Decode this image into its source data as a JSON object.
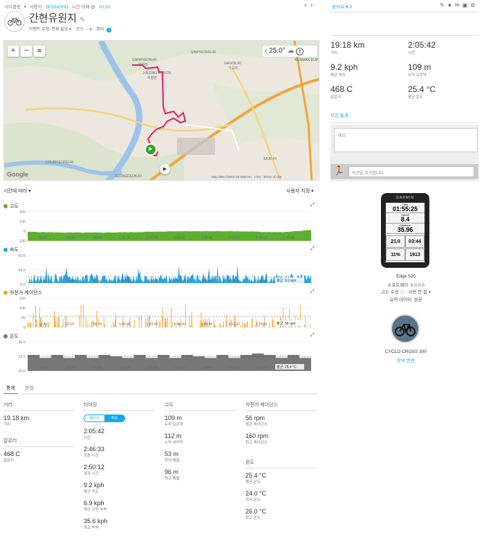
{
  "header": {
    "breadcrumb": [
      "사이클링",
      "▾",
      "사용자",
      "SEONGHO",
      "시간 어제 @",
      "10:33"
    ],
    "title": "간현유원지",
    "meta_event": "이벤트 유형: 분류 없음 ▾",
    "meta_course": "코스: -- ▾",
    "meta_device": "장비:",
    "like_label": "좋아요",
    "like_count": "0"
  },
  "map": {
    "temperature": "25.0°",
    "wind": "6",
    "labels": [
      "GANHYEON-RI",
      "간현리",
      "GAGOK-RI",
      "가곡리",
      "SINPYEONG-RI",
      "MUNMAK-EUP",
      "SEONGDEOK-RI",
      "CHUIBYEONG-RI",
      "SAJE-RI",
      "JIJEONG-MYEON",
      "지정면"
    ],
    "attribution": "Map data ©2016 SK telecom",
    "scale": "1 km",
    "terms": "Terms of Use",
    "google": "Google"
  },
  "summary": [
    {
      "value": "19.18 km",
      "label": "거리"
    },
    {
      "value": "2:05:42",
      "label": "시간"
    },
    {
      "value": "9.2 kph",
      "label": "평균 속도"
    },
    {
      "value": "109 m",
      "label": "누적 오르막"
    },
    {
      "value": "468 C",
      "label": "칼로리"
    },
    {
      "value": "25.4 °C",
      "label": "평균 온도"
    }
  ],
  "all_stats_link": "모든 통계",
  "notes_placeholder": "메모",
  "comment_placeholder": "의견을 추가합니다.",
  "device": {
    "brand": "GARMIN",
    "screen": [
      [
        "Time",
        "01:55:25"
      ],
      [
        "Speed",
        "8.4"
      ],
      [
        "Distance",
        "35.96"
      ]
    ],
    "lap_speed": "21.0",
    "current_lap": "03:44",
    "grade": "11%",
    "total_ascent": "1913",
    "name": "Edge 520",
    "software": "소프트웨어: 6.0.0.0",
    "elev_correct": "고도 수정",
    "elev_value": ": 사용 안 함 ▾",
    "data_source": "요약 데이터: 원본"
  },
  "bike": {
    "name": "CYCLO CROSS 300",
    "change": "장비 변경"
  },
  "charts_header": {
    "left": "시간에 따라 ▾",
    "right": "사용자 지정 ▾"
  },
  "charts": [
    {
      "title": "고도",
      "color": "#5cb030",
      "yticks": [
        "200",
        "100",
        "0",
        "-100"
      ],
      "avg": ""
    },
    {
      "title": "속도",
      "color": "#2aa4e0",
      "yticks": [
        "50.0",
        "25.0",
        "0.0"
      ],
      "avg": "평균: 9.2 kph"
    },
    {
      "title": "자전거 케이던스",
      "color": "#f39c26",
      "yticks": [
        "150",
        "100",
        "50",
        "0"
      ],
      "avg": "평균: 56 rpm"
    },
    {
      "title": "온도",
      "color": "#777777",
      "yticks": [
        "30.0",
        "25.0",
        "20.0"
      ],
      "avg": "평균: 25.4 °C"
    }
  ],
  "xticks": [
    "16:40",
    "33:20",
    "50:00",
    "1:06:40",
    "1:23:20",
    "1:40:00",
    "1:56:40",
    "2:13:20",
    "2:30:00",
    "2:46:40"
  ],
  "tabs": [
    "통계",
    "분할"
  ],
  "stats": {
    "distance": {
      "heading": "거리",
      "items": [
        {
          "value": "19.18 km",
          "label": "거리"
        }
      ]
    },
    "calories": {
      "heading": "칼로리",
      "items": [
        {
          "value": "468 C",
          "label": "칼로리"
        }
      ]
    },
    "timing": {
      "heading": "타이밍",
      "toggle": [
        "페이스",
        "속도"
      ],
      "items": [
        {
          "value": "2:05:42",
          "label": "시간"
        },
        {
          "value": "2:46:33",
          "label": "이동 시간"
        },
        {
          "value": "2:50:12",
          "label": "경과 시간"
        },
        {
          "value": "9.2 kph",
          "label": "평균 속도"
        },
        {
          "value": "6.9 kph",
          "label": "평균 이동 속력"
        },
        {
          "value": "35.6 kph",
          "label": "최고 속력"
        }
      ]
    },
    "elevation": {
      "heading": "고도",
      "items": [
        {
          "value": "109 m",
          "label": "누적 오르막"
        },
        {
          "value": "112 m",
          "label": "누적 내리막"
        },
        {
          "value": "53 m",
          "label": "최저 해발"
        },
        {
          "value": "96 m",
          "label": "최고 해발"
        }
      ]
    },
    "cadence": {
      "heading": "자전거 케이던스",
      "items": [
        {
          "value": "56 rpm",
          "label": "평균 케이던스"
        },
        {
          "value": "160 rpm",
          "label": "최고 케이던스"
        }
      ]
    },
    "temperature": {
      "heading": "온도",
      "items": [
        {
          "value": "25.4 °C",
          "label": "평균 온도"
        },
        {
          "value": "24.0 °C",
          "label": "최저 온도"
        },
        {
          "value": "26.0 °C",
          "label": "최고 온도"
        }
      ]
    }
  }
}
